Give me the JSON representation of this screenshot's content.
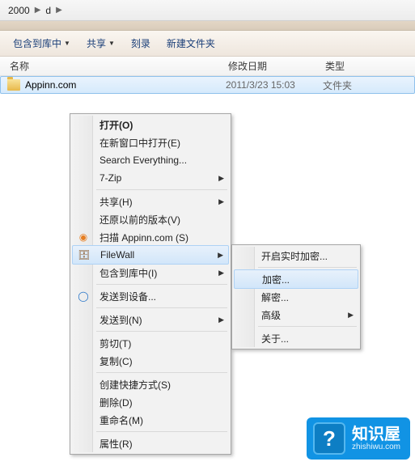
{
  "breadcrumb": {
    "segments": [
      "2000",
      "d"
    ]
  },
  "toolbar": {
    "include": "包含到库中",
    "share": "共享",
    "burn": "刻录",
    "new_folder": "新建文件夹"
  },
  "columns": {
    "name": "名称",
    "date": "修改日期",
    "type": "类型"
  },
  "file_row": {
    "name": "Appinn.com",
    "date": "2011/3/23 15:03",
    "type": "文件夹"
  },
  "context_menu": {
    "open": "打开(O)",
    "open_new_window": "在新窗口中打开(E)",
    "search_everything": "Search Everything...",
    "seven_zip": "7-Zip",
    "share": "共享(H)",
    "restore_previous": "还原以前的版本(V)",
    "scan": "扫描 Appinn.com (S)",
    "filewall": "FileWall",
    "include_in_lib": "包含到库中(I)",
    "send_to_device": "发送到设备...",
    "send_to": "发送到(N)",
    "cut": "剪切(T)",
    "copy": "复制(C)",
    "create_shortcut": "创建快捷方式(S)",
    "delete": "删除(D)",
    "rename": "重命名(M)",
    "properties": "属性(R)"
  },
  "submenu": {
    "realtime_encrypt": "开启实时加密...",
    "encrypt": "加密...",
    "decrypt": "解密...",
    "advanced": "高级",
    "about": "关于..."
  },
  "watermark": {
    "title": "知识屋",
    "url": "zhishiwu.com"
  }
}
